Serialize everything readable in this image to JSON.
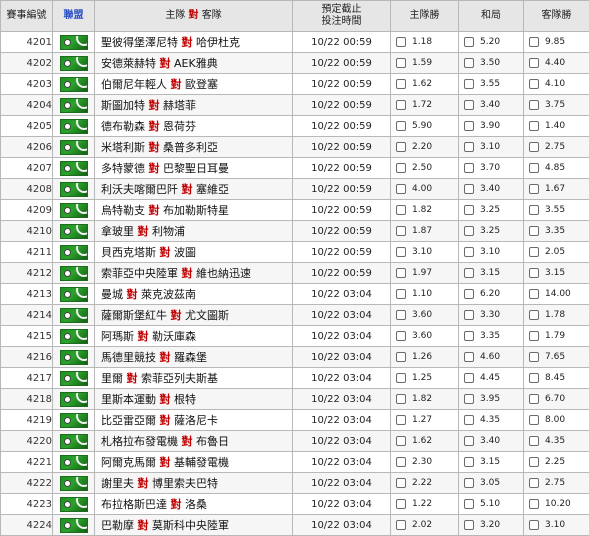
{
  "header": {
    "match_no": "賽事編號",
    "league": "聯盟",
    "home": "主隊",
    "vs": "對",
    "away": "客隊",
    "time_line1": "預定截止",
    "time_line2": "投注時間",
    "home_win": "主隊勝",
    "draw": "和局",
    "away_win": "客隊勝"
  },
  "vs_text": "對",
  "league_icon": "soccer-flag-icon",
  "colors": {
    "vs": "#c00000",
    "league_header": "#2b51c8",
    "header_bg": "#e6e6e6",
    "border": "#b8b8b8"
  },
  "matches": [
    {
      "id": "4201",
      "home": "聖彼得堡澤尼特",
      "away": "哈伊杜克",
      "time": "10/22 00:59",
      "home_odds": "1.18",
      "draw_odds": "5.20",
      "away_odds": "9.85"
    },
    {
      "id": "4202",
      "home": "安德萊赫特",
      "away": "AEK雅典",
      "time": "10/22 00:59",
      "home_odds": "1.59",
      "draw_odds": "3.50",
      "away_odds": "4.40"
    },
    {
      "id": "4203",
      "home": "伯爾尼年輕人",
      "away": "歐登塞",
      "time": "10/22 00:59",
      "home_odds": "1.62",
      "draw_odds": "3.55",
      "away_odds": "4.10"
    },
    {
      "id": "4204",
      "home": "斯圖加特",
      "away": "赫塔菲",
      "time": "10/22 00:59",
      "home_odds": "1.72",
      "draw_odds": "3.40",
      "away_odds": "3.75"
    },
    {
      "id": "4205",
      "home": "德布勒森",
      "away": "恩荷芬",
      "time": "10/22 00:59",
      "home_odds": "5.90",
      "draw_odds": "3.90",
      "away_odds": "1.40"
    },
    {
      "id": "4206",
      "home": "米塔利斯",
      "away": "桑普多利亞",
      "time": "10/22 00:59",
      "home_odds": "2.20",
      "draw_odds": "3.10",
      "away_odds": "2.75"
    },
    {
      "id": "4207",
      "home": "多特蒙德",
      "away": "巴黎聖日耳曼",
      "time": "10/22 00:59",
      "home_odds": "2.50",
      "draw_odds": "3.70",
      "away_odds": "4.85"
    },
    {
      "id": "4208",
      "home": "利沃夫喀爾巴阡",
      "away": "塞維亞",
      "time": "10/22 00:59",
      "home_odds": "4.00",
      "draw_odds": "3.40",
      "away_odds": "1.67"
    },
    {
      "id": "4209",
      "home": "烏特勒支",
      "away": "布加勒斯特星",
      "time": "10/22 00:59",
      "home_odds": "1.82",
      "draw_odds": "3.25",
      "away_odds": "3.55"
    },
    {
      "id": "4210",
      "home": "拿玻里",
      "away": "利物浦",
      "time": "10/22 00:59",
      "home_odds": "1.87",
      "draw_odds": "3.25",
      "away_odds": "3.35"
    },
    {
      "id": "4211",
      "home": "貝西克塔斯",
      "away": "波圖",
      "time": "10/22 00:59",
      "home_odds": "3.10",
      "draw_odds": "3.10",
      "away_odds": "2.05"
    },
    {
      "id": "4212",
      "home": "索菲亞中央陸軍",
      "away": "維也納迅速",
      "time": "10/22 00:59",
      "home_odds": "1.97",
      "draw_odds": "3.15",
      "away_odds": "3.15"
    },
    {
      "id": "4213",
      "home": "曼城",
      "away": "萊克波茲南",
      "time": "10/22 03:04",
      "home_odds": "1.10",
      "draw_odds": "6.20",
      "away_odds": "14.00"
    },
    {
      "id": "4214",
      "home": "薩爾斯堡紅牛",
      "away": "尤文圖斯",
      "time": "10/22 03:04",
      "home_odds": "3.60",
      "draw_odds": "3.30",
      "away_odds": "1.78"
    },
    {
      "id": "4215",
      "home": "阿瑪斯",
      "away": "勒沃庫森",
      "time": "10/22 03:04",
      "home_odds": "3.60",
      "draw_odds": "3.35",
      "away_odds": "1.79"
    },
    {
      "id": "4216",
      "home": "馬德里競技",
      "away": "羅森堡",
      "time": "10/22 03:04",
      "home_odds": "1.26",
      "draw_odds": "4.60",
      "away_odds": "7.65"
    },
    {
      "id": "4217",
      "home": "里爾",
      "away": "索菲亞列夫斯基",
      "time": "10/22 03:04",
      "home_odds": "1.25",
      "draw_odds": "4.45",
      "away_odds": "8.45"
    },
    {
      "id": "4218",
      "home": "里斯本運動",
      "away": "根特",
      "time": "10/22 03:04",
      "home_odds": "1.82",
      "draw_odds": "3.95",
      "away_odds": "6.70"
    },
    {
      "id": "4219",
      "home": "比亞雷亞爾",
      "away": "薩洛尼卡",
      "time": "10/22 03:04",
      "home_odds": "1.27",
      "draw_odds": "4.35",
      "away_odds": "8.00"
    },
    {
      "id": "4220",
      "home": "札格拉布發電機",
      "away": "布魯日",
      "time": "10/22 03:04",
      "home_odds": "1.62",
      "draw_odds": "3.40",
      "away_odds": "4.35"
    },
    {
      "id": "4221",
      "home": "阿爾克馬爾",
      "away": "基輔發電機",
      "time": "10/22 03:04",
      "home_odds": "2.30",
      "draw_odds": "3.15",
      "away_odds": "2.25"
    },
    {
      "id": "4222",
      "home": "謝里夫",
      "away": "博里索夫巴特",
      "time": "10/22 03:04",
      "home_odds": "2.22",
      "draw_odds": "3.05",
      "away_odds": "2.75"
    },
    {
      "id": "4223",
      "home": "布拉格斯巴達",
      "away": "洛桑",
      "time": "10/22 03:04",
      "home_odds": "1.22",
      "draw_odds": "5.10",
      "away_odds": "10.20"
    },
    {
      "id": "4224",
      "home": "巴勒摩",
      "away": "莫斯科中央陸軍",
      "time": "10/22 03:04",
      "home_odds": "2.02",
      "draw_odds": "3.20",
      "away_odds": "3.10"
    }
  ]
}
